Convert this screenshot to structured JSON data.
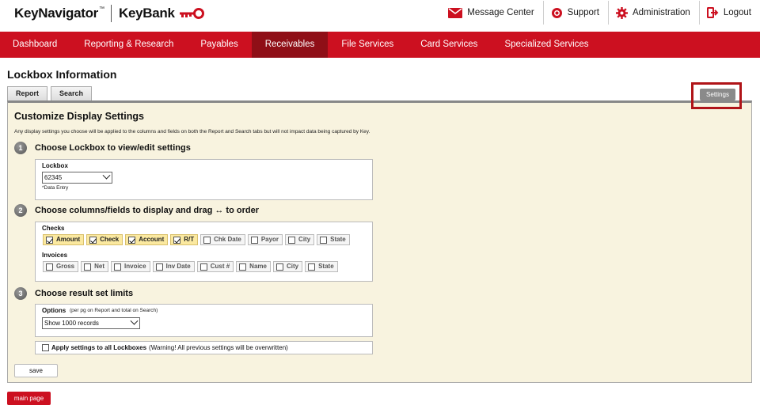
{
  "header": {
    "brand": "KeyNavigator",
    "trademark": "™",
    "bank": "KeyBank",
    "utility": [
      {
        "label": "Message Center",
        "icon": "envelope-icon"
      },
      {
        "label": "Support",
        "icon": "lifebuoy-icon"
      },
      {
        "label": "Administration",
        "icon": "gear-icon"
      },
      {
        "label": "Logout",
        "icon": "logout-icon"
      }
    ]
  },
  "nav": {
    "items": [
      "Dashboard",
      "Reporting & Research",
      "Payables",
      "Receivables",
      "File Services",
      "Card Services",
      "Specialized Services"
    ],
    "active": "Receivables"
  },
  "page": {
    "title": "Lockbox Information",
    "tabs": [
      "Report",
      "Search"
    ],
    "settings_label": "Settings"
  },
  "panel": {
    "heading": "Customize Display Settings",
    "description": "Any display settings you choose will be applied to the columns and fields on both the Report and Search tabs but will not impact data being captured by Key.",
    "step1": {
      "number": "1",
      "label": "Choose Lockbox to view/edit settings",
      "field_label": "Lockbox",
      "selected": "62345",
      "note": "*Data Entry"
    },
    "step2": {
      "number": "2",
      "label": "Choose columns/fields to display and drag ↔ to order",
      "checks_label": "Checks",
      "checks": [
        {
          "label": "Amount",
          "checked": true
        },
        {
          "label": "Check",
          "checked": true
        },
        {
          "label": "Account",
          "checked": true
        },
        {
          "label": "R/T",
          "checked": true
        },
        {
          "label": "Chk Date",
          "checked": false
        },
        {
          "label": "Payor",
          "checked": false
        },
        {
          "label": "City",
          "checked": false
        },
        {
          "label": "State",
          "checked": false
        }
      ],
      "invoices_label": "Invoices",
      "invoices": [
        {
          "label": "Gross",
          "checked": false
        },
        {
          "label": "Net",
          "checked": false
        },
        {
          "label": "Invoice",
          "checked": false
        },
        {
          "label": "Inv Date",
          "checked": false
        },
        {
          "label": "Cust #",
          "checked": false
        },
        {
          "label": "Name",
          "checked": false
        },
        {
          "label": "City",
          "checked": false
        },
        {
          "label": "State",
          "checked": false
        }
      ]
    },
    "step3": {
      "number": "3",
      "label": "Choose result set limits",
      "options_label": "Options",
      "options_note": "(per pg on Report and total on Search)",
      "selected": "Show 1000 records"
    },
    "apply": {
      "label": "Apply settings to all Lockboxes",
      "warning": "(Warning! All previous settings will be overwritten)"
    },
    "save_label": "save"
  },
  "footer": {
    "main_page_label": "main page"
  },
  "colors": {
    "brand_red": "#cc1020",
    "active_nav": "#8f0f17",
    "panel_bg": "#f8f3df",
    "checked_chip": "#fbe9a0"
  }
}
